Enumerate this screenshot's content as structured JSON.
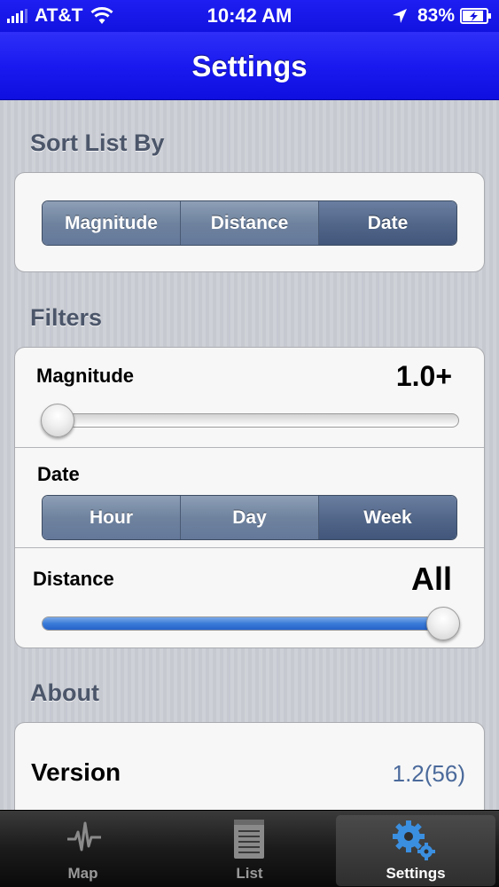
{
  "status_bar": {
    "carrier": "AT&T",
    "time": "10:42 AM",
    "battery": "83%"
  },
  "nav": {
    "title": "Settings"
  },
  "sort": {
    "header": "Sort List By",
    "options": [
      "Magnitude",
      "Distance",
      "Date"
    ],
    "selected": "Date"
  },
  "filters": {
    "header": "Filters",
    "magnitude": {
      "label": "Magnitude",
      "value": "1.0+",
      "level": 0.0
    },
    "date": {
      "label": "Date",
      "options": [
        "Hour",
        "Day",
        "Week"
      ],
      "selected": "Week"
    },
    "distance": {
      "label": "Distance",
      "value": "All",
      "level": 1.0
    }
  },
  "about": {
    "header": "About",
    "version_label": "Version",
    "version_value": "1.2(56)"
  },
  "tabbar": {
    "tabs": [
      {
        "label": "Map",
        "icon": "heartbeat-icon"
      },
      {
        "label": "List",
        "icon": "notepad-icon"
      },
      {
        "label": "Settings",
        "icon": "gears-icon"
      }
    ],
    "selected": "Settings"
  },
  "colors": {
    "bar_blue": "#1a1af0",
    "segment_selected": "#4a5f83",
    "slider_fill": "#3a7bd8",
    "version_value": "#4b6a9b"
  }
}
